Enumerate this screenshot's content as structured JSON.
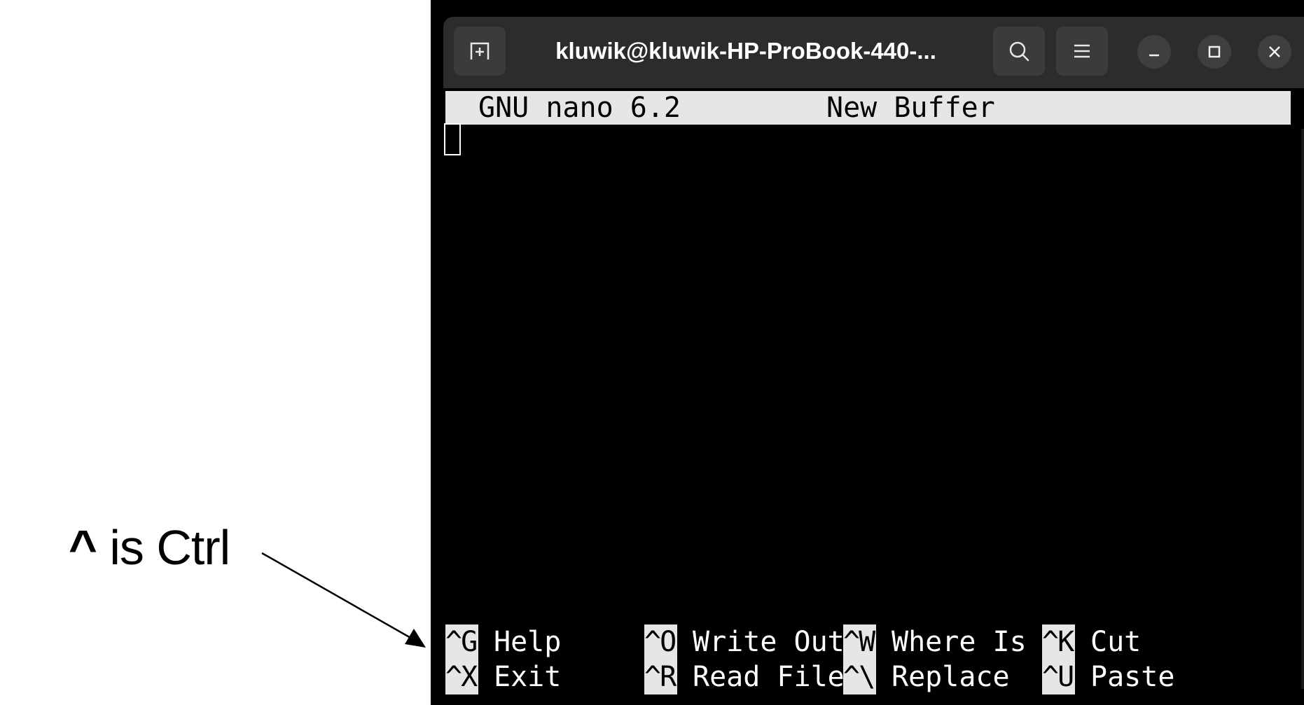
{
  "annotation": {
    "caret": "^",
    "text": " is Ctrl"
  },
  "window": {
    "title": "kluwik@kluwik-HP-ProBook-440-...",
    "icons": {
      "new_tab": "new-tab-icon",
      "search": "search-icon",
      "menu": "hamburger-menu-icon",
      "minimize": "minimize-icon",
      "maximize": "maximize-icon",
      "close": "close-icon"
    }
  },
  "nano": {
    "version": "GNU nano 6.2",
    "buffer_name": "New Buffer",
    "shortcuts": [
      [
        {
          "key": "^G",
          "label": "Help"
        },
        {
          "key": "^O",
          "label": "Write Out"
        },
        {
          "key": "^W",
          "label": "Where Is"
        },
        {
          "key": "^K",
          "label": "Cut"
        }
      ],
      [
        {
          "key": "^X",
          "label": "Exit"
        },
        {
          "key": "^R",
          "label": "Read File"
        },
        {
          "key": "^\\",
          "label": "Replace"
        },
        {
          "key": "^U",
          "label": "Paste"
        }
      ]
    ]
  },
  "colors": {
    "terminal_bg": "#000000",
    "titlebar_bg": "#2c2c2c",
    "highlight_bg": "#e6e6e6",
    "text": "#ffffff"
  }
}
